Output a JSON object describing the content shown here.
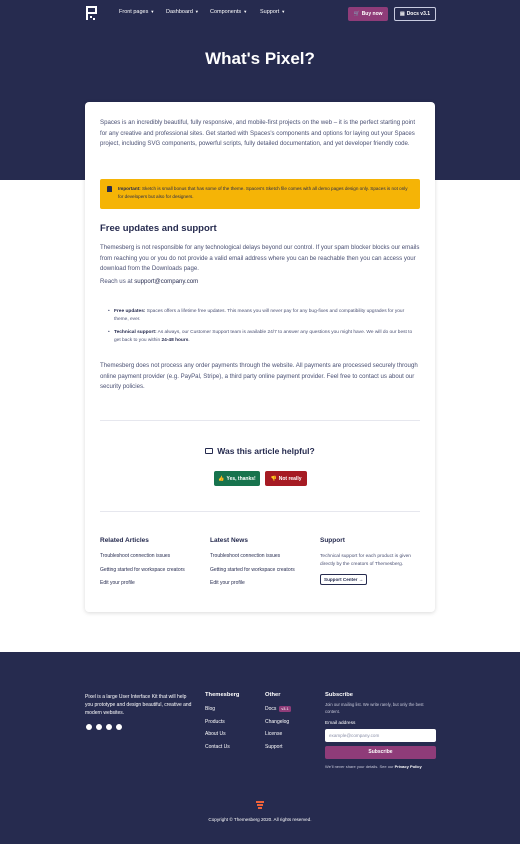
{
  "nav": {
    "items": [
      {
        "label": "Front pages"
      },
      {
        "label": "Dashboard"
      },
      {
        "label": "Components"
      },
      {
        "label": "Support"
      }
    ],
    "buy_label": "Buy now",
    "docs_label": "Docs v3.1"
  },
  "hero": {
    "title": "What's Pixel?"
  },
  "article": {
    "intro": "Spaces is an incredibly beautiful, fully responsive, and mobile-first projects on the web – it is the perfect starting point for any creative and professional sites. Get started with Spaces's components and options for laying out your Spaces project, including SVG components, powerful scripts, fully detailed documentation, and yet developer friendly code.",
    "alert_strong": "Important:",
    "alert_text": " Sketch is small bonus that has some of the theme. Spaces's Sketch file comes with all demo pages design only. Spaces is not only for developers but also for designers.",
    "heading": "Free updates and support",
    "para2": "Themesberg is not responsible for any technological delays beyond our control. If your spam blocker blocks our emails from reaching you or you do not provide a valid email address where you can be reachable then you can access your download from the Downloads page.",
    "reach_prefix": "Reach us at ",
    "reach_email": "support@company.com",
    "list": [
      {
        "strong": "Free updates:",
        "text": " Spaces offers a lifetime free updates. This means you will never pay for any bug-fixes and compatibility upgrades for your theme, ever."
      },
      {
        "strong": "Technical support:",
        "text": " As always, our Customer Support team is available 24/7 to answer any questions you might have. We will do our best to get back to you within ",
        "strong2": "24-48 hours",
        "tail": "."
      }
    ],
    "para3": "Themesberg does not process any order payments through the website. All payments are processed securely through online payment provider (e.g. PayPal, Stripe), a third party online payment provider. Feel free to contact us about our security policies.",
    "helpful": "Was this article helpful?",
    "yes_label": "Yes, thanks!",
    "no_label": "Not really"
  },
  "related": {
    "title": "Related Articles",
    "links": [
      "Troubleshoot connection issues",
      "Getting started for workspace creators",
      "Edit your profile"
    ]
  },
  "news": {
    "title": "Latest News",
    "links": [
      "Troubleshoot connection issues",
      "Getting started for workspace creators",
      "Edit your profile"
    ]
  },
  "support": {
    "title": "Support",
    "desc": "Technical support for each product is given directly by the creators of Themesberg.",
    "button": "Support Center"
  },
  "footer": {
    "about": "Pixel is a large User Interface Kit that will help you prototype and design beautiful, creative and modern websites.",
    "themesberg": {
      "title": "Themesberg",
      "links": [
        "Blog",
        "Products",
        "About Us",
        "Contact Us"
      ]
    },
    "other": {
      "title": "Other",
      "links": [
        "Docs",
        "Changelog",
        "License",
        "Support"
      ],
      "docs_badge": "v3.1"
    },
    "subscribe": {
      "title": "Subscribe",
      "desc": "Join our mailing list. We write rarely, but only the best content.",
      "label": "Email address",
      "placeholder": "example@company.com",
      "button": "Subscribe",
      "note_prefix": "We'll never share your details. See our ",
      "note_link": "Privacy Policy"
    },
    "copyright": "Copyright © Themesberg 2020. All rights reserved."
  },
  "colors": {
    "navy": "#262b4f",
    "brand": "#8f3c79",
    "warning": "#f5b406",
    "success": "#17734d",
    "danger": "#a61b23"
  }
}
